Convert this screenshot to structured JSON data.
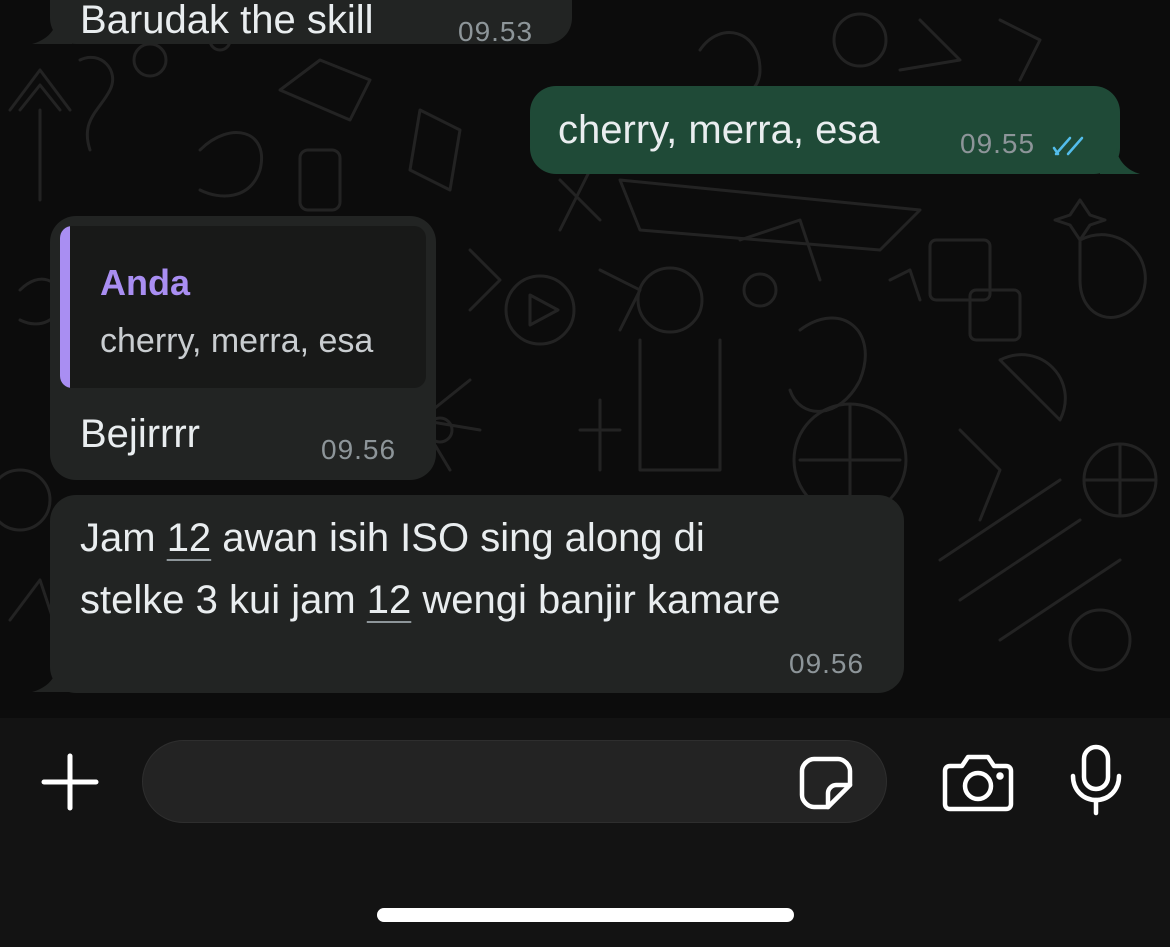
{
  "messages": [
    {
      "direction": "in",
      "text": "Barudak the skill",
      "time": "09.53"
    },
    {
      "direction": "out",
      "text": "cherry, merra, esa",
      "time": "09.55",
      "status": "read"
    },
    {
      "direction": "in",
      "reply_to": {
        "author": "Anda",
        "text": "cherry, merra, esa"
      },
      "text": "Bejirrrr",
      "time": "09.56"
    },
    {
      "direction": "in",
      "line1": [
        "Jam ",
        "12",
        " awan isih ISO sing along di"
      ],
      "line2": [
        "stelke 3 kui jam ",
        "12",
        " wengi banjir kamare"
      ],
      "time": "09.56"
    }
  ],
  "composer": {
    "placeholder": ""
  },
  "icons": {
    "attach": "plus-icon",
    "sticker": "sticker-icon",
    "camera": "camera-icon",
    "mic": "microphone-icon",
    "read_receipt": "double-check-icon"
  },
  "colors": {
    "outgoing_bubble": "#1f4a37",
    "incoming_bubble": "#222423",
    "quote_accent": "#a98ef2",
    "read_tick": "#53bdeb"
  }
}
